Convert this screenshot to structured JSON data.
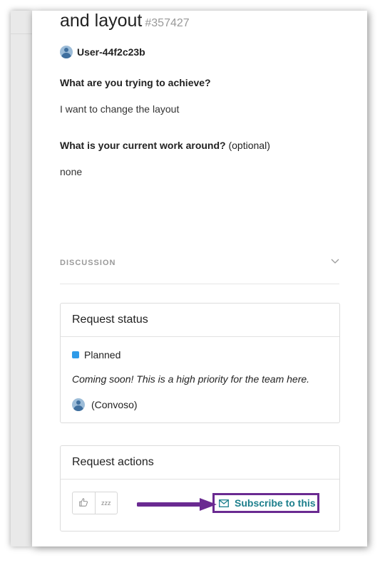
{
  "request": {
    "title": "and layout",
    "number": "#357427",
    "author": "User-44f2c23b"
  },
  "questions": [
    {
      "label": "What are you trying to achieve?",
      "optional": "",
      "answer": "I want to change the layout"
    },
    {
      "label": "What is your current work around?",
      "optional": "(optional)",
      "answer": "none"
    }
  ],
  "discussion": {
    "label": "DISCUSSION"
  },
  "status_card": {
    "heading": "Request status",
    "status": "Planned",
    "status_color": "#2f9be8",
    "note": "Coming soon! This is a high priority for the team here.",
    "owner": "(Convoso)"
  },
  "actions_card": {
    "heading": "Request actions",
    "upvote_icon": "thumbs-up-icon",
    "snooze_icon": "snooze-icon",
    "snooze_glyph": "zzz",
    "subscribe_label": "Subscribe to this",
    "subscribe_icon": "mail-icon"
  },
  "colors": {
    "accent_teal": "#1d7f8c",
    "annotation_purple": "#6a2a91"
  }
}
